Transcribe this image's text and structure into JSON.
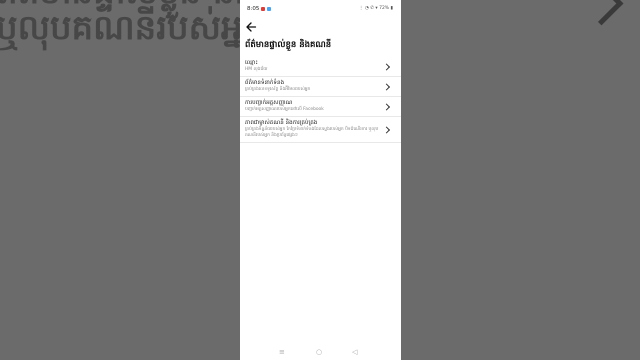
{
  "background": {
    "line1": "ព័ត៌មានផ្ទាល់ខ្លួន និងគណនី",
    "line2": "ឬលុបគណនីរបស់អ្នក និងព្រ័"
  },
  "status_bar": {
    "time": "8:05",
    "right": "⋮ ◔ ✆ ▾ 72% ▮"
  },
  "page": {
    "title": "ព័ត៌មានផ្ទាល់ខ្លួន និងគណនី"
  },
  "items": [
    {
      "title": "ឈ្មោះ",
      "subtitle": "HM លុងជ័យ"
    },
    {
      "title": "ព័ត៌មានទំនាក់ទំនង",
      "subtitle": "គ្រប់គ្រងលេខទូរស័ព្ទ និងអ៊ីមែលរបស់អ្នក"
    },
    {
      "title": "ការបញ្ជាក់អត្តសញ្ញាណ",
      "subtitle": "បញ្ជាក់អត្តសញ្ញាណរបស់អ្នកនៅលើ Facebook"
    },
    {
      "title": "ភាពជាម្ចាស់គណនី និងការគ្រប់គ្រង",
      "subtitle": "គ្រប់គ្រងទិន្នន័យរបស់អ្នក កែប្រែទំនាក់ទំនងដែលស្នងរបស់អ្នក បិទដំណើរការ ឬលុបគណនីរបស់អ្នក និងប្រព័ន្ធផ្សេងៗ"
    }
  ],
  "nav": {
    "menu": "≡",
    "home": "○",
    "back": "◁"
  },
  "colors": {
    "status_red": "#e53935",
    "status_blue": "#42a5f5"
  }
}
